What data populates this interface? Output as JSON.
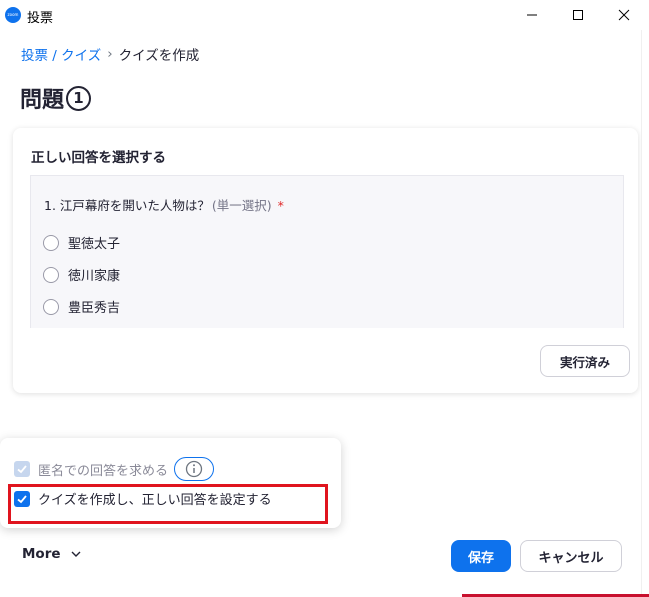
{
  "window": {
    "title": "投票",
    "app_icon_text": "zoom",
    "controls": [
      "minimize-icon",
      "maximize-icon",
      "close-icon"
    ]
  },
  "breadcrumb": {
    "root": "投票 / クイズ",
    "separator": "›",
    "current": "クイズを作成"
  },
  "page": {
    "title": "問題",
    "question_number": "1"
  },
  "card": {
    "heading": "正しい回答を選択する",
    "question": {
      "text": "1. 江戸幕府を開いた人物は？",
      "type": "(単一選択)",
      "required_mark": "*"
    },
    "options": [
      "聖徳太子",
      "徳川家康",
      "豊臣秀吉"
    ],
    "done_button": "実行済み"
  },
  "settings": {
    "anonymous": {
      "label": "匿名での回答を求める",
      "checked": true,
      "disabled": true
    },
    "quiz": {
      "label": "クイズを作成し、正しい回答を設定する",
      "checked": true
    }
  },
  "footer": {
    "more": "More",
    "save": "保存",
    "cancel": "キャンセル"
  },
  "colors": {
    "accent": "#0e72ed",
    "highlight": "#e0141e",
    "text": "#232333"
  }
}
